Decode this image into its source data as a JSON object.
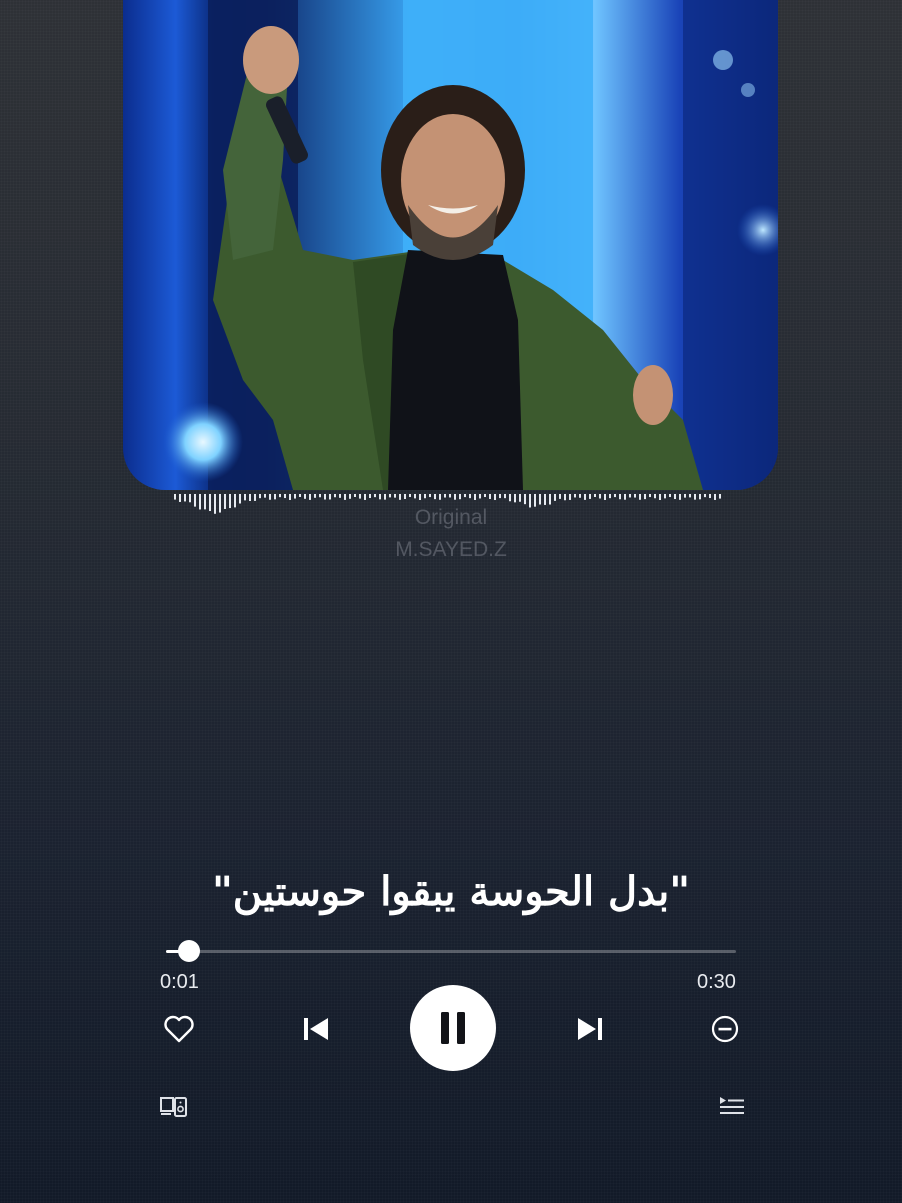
{
  "track": {
    "tag": "Original",
    "credit": "M.SAYED.Z",
    "lyric": "\"بدل الحوسة يبقوا حوستين\""
  },
  "player": {
    "elapsed": "0:01",
    "total": "0:30",
    "progress_fraction": 0.04,
    "state": "playing"
  },
  "icons": {
    "like": "heart-outline-icon",
    "previous": "skip-previous-icon",
    "pause": "pause-icon",
    "next": "skip-next-icon",
    "remove": "minus-circle-icon",
    "devices": "connect-device-icon",
    "queue": "queue-icon"
  },
  "colors": {
    "background_top": "#2e3136",
    "background_bottom": "#121a28",
    "accent": "#ffffff",
    "cover_blue": "#2b86e6",
    "jacket_green": "#3c5a2e"
  }
}
